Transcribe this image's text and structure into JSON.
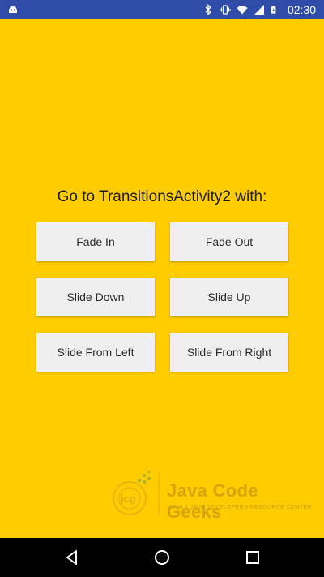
{
  "status_bar": {
    "time": "02:30",
    "icons": [
      "android-icon",
      "bluetooth-icon",
      "vibrate-icon",
      "wifi-icon",
      "signal-icon",
      "battery-charging-icon"
    ],
    "background": "#2F4DA8"
  },
  "screen": {
    "background": "#FFCC00",
    "heading": "Go to TransitionsActivity2 with:"
  },
  "buttons": {
    "fade_in": "Fade In",
    "fade_out": "Fade Out",
    "slide_down": "Slide Down",
    "slide_up": "Slide Up",
    "slide_from_left": "Slide From Left",
    "slide_from_right": "Slide From Right"
  },
  "watermark": {
    "title": "Java Code Geeks",
    "tagline": "JAVA 2 JAVA DEVELOPERS RESOURCE CENTER"
  },
  "nav_bar": {
    "icons": [
      "back-icon",
      "home-icon",
      "recent-apps-icon"
    ]
  }
}
